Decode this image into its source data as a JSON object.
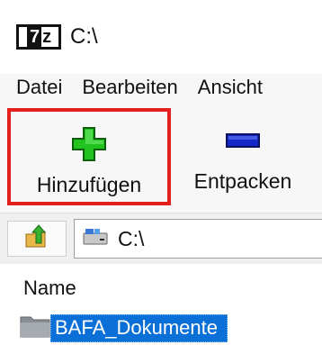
{
  "window": {
    "title": "C:\\",
    "logo_seven": "7",
    "logo_z": "z"
  },
  "menu": {
    "items": [
      "Datei",
      "Bearbeiten",
      "Ansicht"
    ]
  },
  "toolbar": {
    "add_label": "Hinzufügen",
    "extract_label": "Entpacken",
    "add_icon": "plus-icon",
    "extract_icon": "minus-icon",
    "highlight_color": "#e51e1e"
  },
  "addressbar": {
    "path": "C:\\"
  },
  "filelist": {
    "column_name": "Name",
    "items": [
      {
        "name": "BAFA_Dokumente",
        "selected": true
      }
    ]
  },
  "colors": {
    "selection": "#0a6fd6",
    "plus_green": "#22c21f",
    "minus_blue": "#1428c8"
  }
}
